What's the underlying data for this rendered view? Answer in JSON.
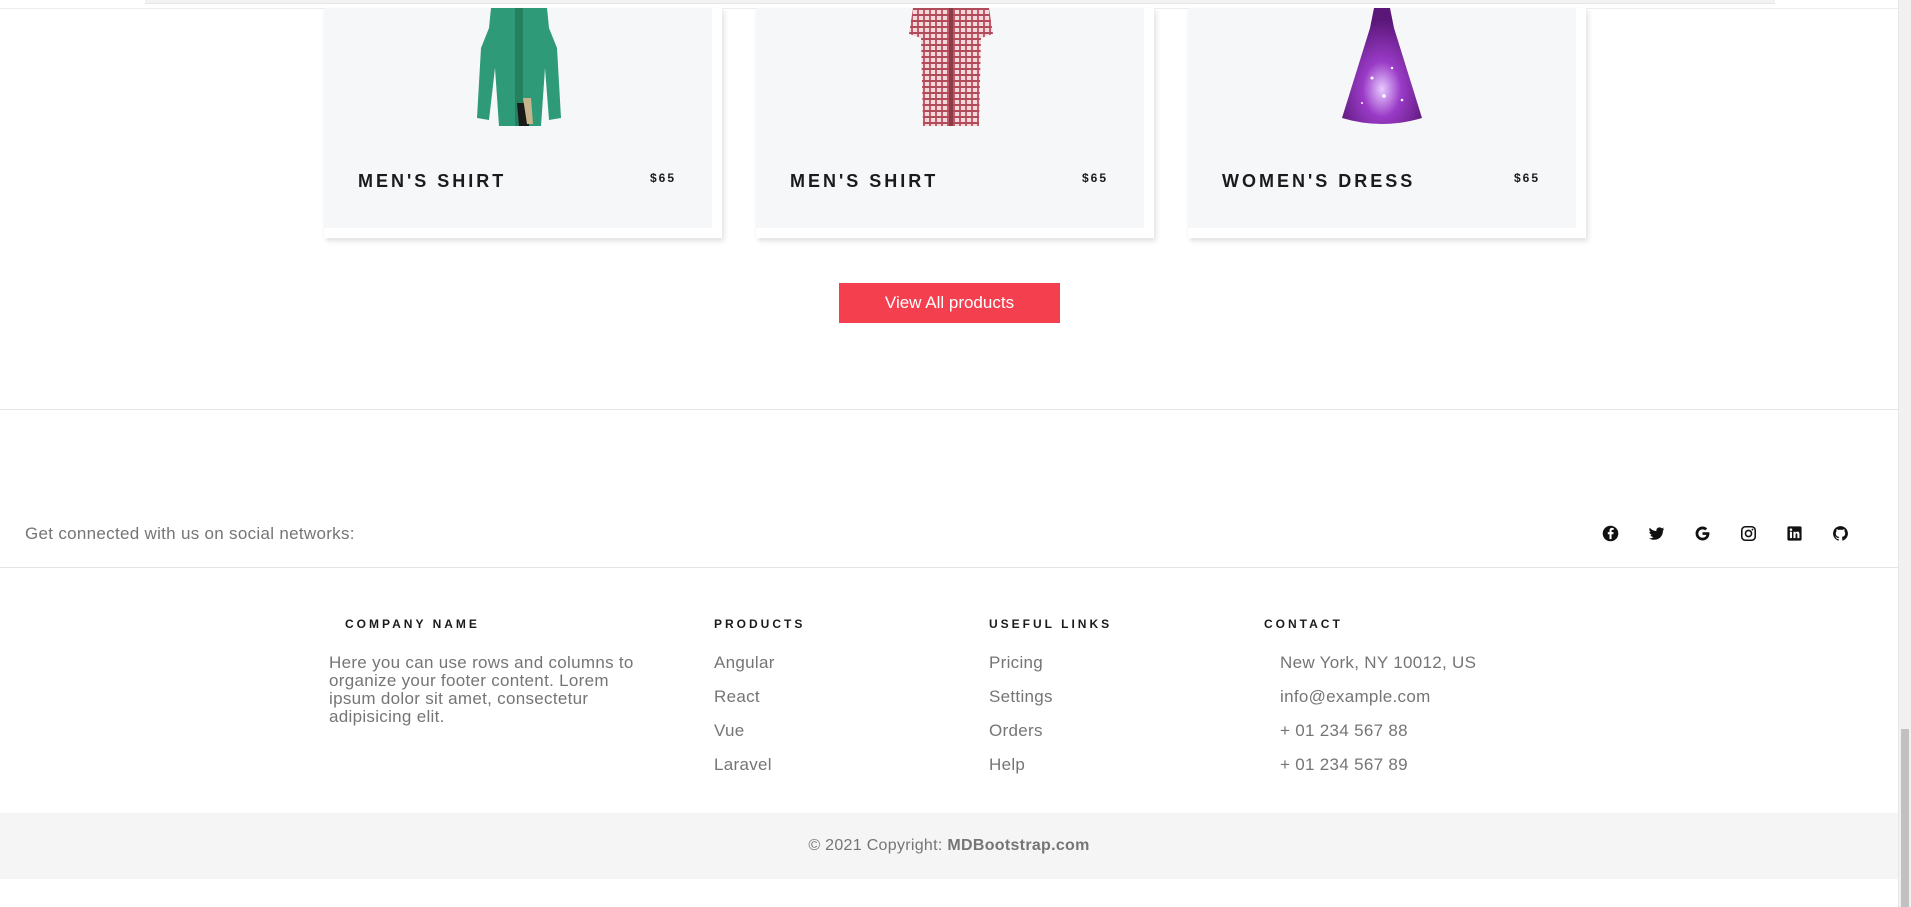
{
  "products": [
    {
      "title": "MEN'S SHIRT",
      "price": "$65",
      "image": "green-shirt"
    },
    {
      "title": "MEN'S SHIRT",
      "price": "$65",
      "image": "checked-shirt"
    },
    {
      "title": "WOMEN'S DRESS",
      "price": "$65",
      "image": "purple-dress"
    }
  ],
  "view_all_label": "View All products",
  "footer": {
    "social_text": "Get connected with us on social networks:",
    "social_icons": [
      "facebook-icon",
      "twitter-icon",
      "google-icon",
      "instagram-icon",
      "linkedin-icon",
      "github-icon"
    ],
    "company": {
      "title": "COMPANY NAME",
      "text": "Here you can use rows and columns to organize your footer content. Lorem ipsum dolor sit amet, consectetur adipisicing elit."
    },
    "products": {
      "title": "PRODUCTS",
      "links": [
        "Angular",
        "React",
        "Vue",
        "Laravel"
      ]
    },
    "useful_links": {
      "title": "USEFUL LINKS",
      "links": [
        "Pricing",
        "Settings",
        "Orders",
        "Help"
      ]
    },
    "contact": {
      "title": "CONTACT",
      "items": [
        "New York, NY 10012, US",
        "info@example.com",
        "+ 01 234 567 88",
        "+ 01 234 567 89"
      ]
    },
    "copyright_prefix": "© 2021 Copyright:",
    "copyright_brand": "MDBootstrap.com"
  },
  "colors": {
    "accent": "#f43f4f",
    "text_muted": "#757575",
    "card_bg": "#f6f7f9"
  }
}
